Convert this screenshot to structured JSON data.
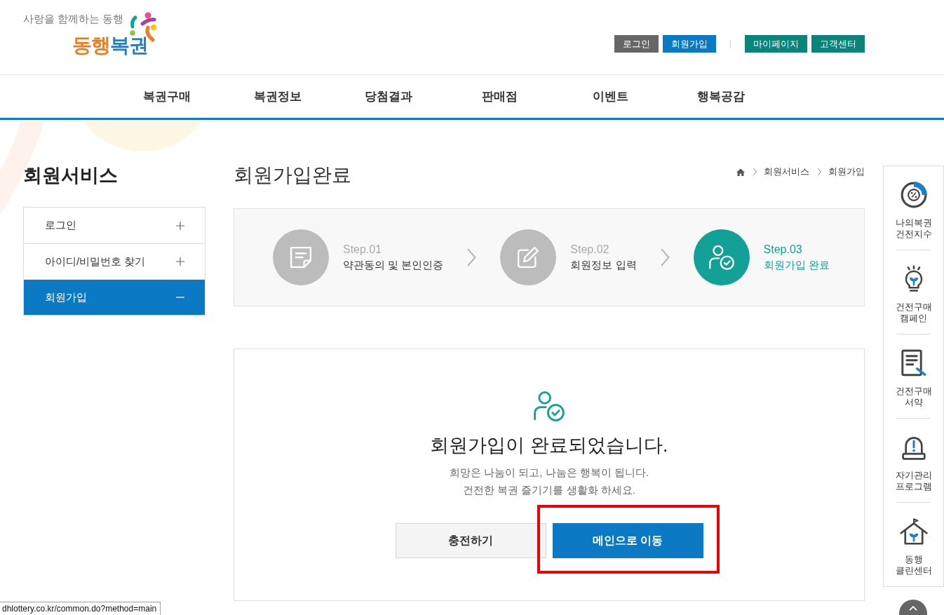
{
  "header": {
    "logo": {
      "tagline": "사랑을 함께하는 동행",
      "wordmark": [
        {
          "text": "동행",
          "color": "#f17b1b"
        },
        {
          "text": "복권",
          "color": "#1b7fcb"
        }
      ]
    },
    "account_links": [
      {
        "label": "로그인",
        "color": "#666666"
      },
      {
        "label": "회원가입",
        "color": "#0b79c4"
      }
    ],
    "service_links": [
      {
        "label": "마이페이지",
        "color": "#0b8579"
      },
      {
        "label": "고객센터",
        "color": "#0b8579"
      }
    ]
  },
  "nav": [
    "복권구매",
    "복권정보",
    "당첨결과",
    "판매점",
    "이벤트",
    "행복공감"
  ],
  "sidebar": {
    "title": "회원서비스",
    "items": [
      {
        "label": "로그인",
        "expanded": false,
        "selected": false
      },
      {
        "label": "아이디/비밀번호 찾기",
        "expanded": false,
        "selected": false
      },
      {
        "label": "회원가입",
        "expanded": true,
        "selected": true
      }
    ]
  },
  "page": {
    "title": "회원가입완료",
    "breadcrumb": [
      "회원서비스",
      "회원가입"
    ]
  },
  "steps": [
    {
      "number": "Step.01",
      "label": "약관동의 및 본인인증",
      "selected": false
    },
    {
      "number": "Step.02",
      "label": "회원정보 입력",
      "selected": false
    },
    {
      "number": "Step.03",
      "label": "회원가입 완료",
      "selected": true
    }
  ],
  "result": {
    "heading": "회원가입이 완료되었습니다.",
    "lines": [
      "희망은 나눔이 되고, 나눔은 행복이 됩니다.",
      "건전한 복권 즐기기를 생활화 하세요."
    ],
    "buttons": [
      {
        "label": "충전하기",
        "kind": "secondary",
        "highlighted": false
      },
      {
        "label": "메인으로 이동",
        "kind": "primary",
        "highlighted": true
      }
    ]
  },
  "quick_menu": [
    "나의복권 건전지수",
    "건전구매 캠페인",
    "건전구매 서약",
    "자기관리 프로그램",
    "동행 클린센터"
  ],
  "status_bar": "dhlottery.co.kr/common.do?method=main"
}
